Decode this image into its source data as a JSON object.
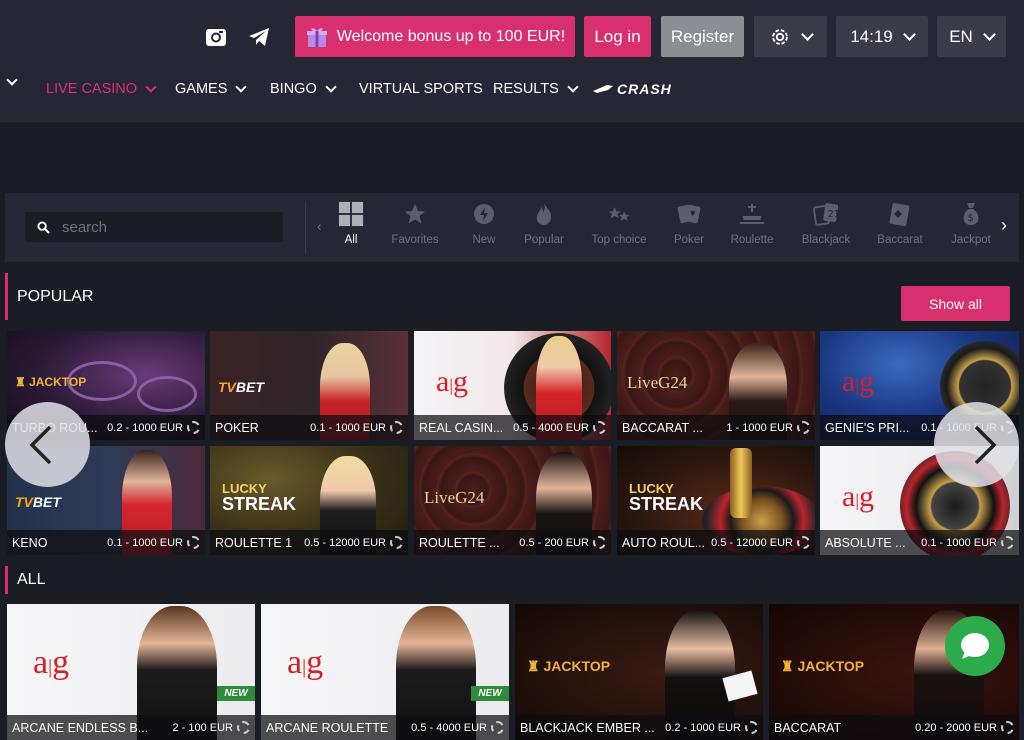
{
  "header": {
    "bonus_label": "Welcome bonus up to 100 EUR!",
    "login_label": "Log in",
    "register_label": "Register",
    "time": "14:19",
    "language": "EN",
    "social_icons": [
      "instagram-icon",
      "telegram-icon"
    ]
  },
  "nav": [
    {
      "label": "LIVE CASINO",
      "active": true
    },
    {
      "label": "GAMES"
    },
    {
      "label": "BINGO"
    },
    {
      "label": "VIRTUAL SPORTS"
    },
    {
      "label": "RESULTS"
    },
    {
      "label": "CRASH"
    }
  ],
  "search": {
    "placeholder": "search"
  },
  "categories": [
    "All",
    "Favorites",
    "New",
    "Popular",
    "Top choice",
    "Poker",
    "Roulette",
    "Blackjack",
    "Baccarat",
    "Jackpot"
  ],
  "sections": {
    "popular_title": "POPULAR",
    "show_all": "Show all",
    "all_title": "ALL"
  },
  "popular_games": [
    {
      "name": "TURBO ROU...",
      "range": "0.2 - 1000 EUR",
      "provider": "JACKTOP"
    },
    {
      "name": "POKER",
      "range": "0.1 - 1000 EUR",
      "provider": "TVBET"
    },
    {
      "name": "REAL CASIN...",
      "range": "0.5 - 4000 EUR",
      "provider": "alg"
    },
    {
      "name": "BACCARAT ...",
      "range": "1 - 1000 EUR",
      "provider": "LiveG24"
    },
    {
      "name": "GENIE'S PRI...",
      "range": "0.1 - 1000 EUR",
      "provider": "alg"
    },
    {
      "name": "KENO",
      "range": "0.1 - 1000 EUR",
      "provider": "TVBET"
    },
    {
      "name": "ROULETTE 1",
      "range": "0.5 - 12000 EUR",
      "provider": "LUCKY STREAK"
    },
    {
      "name": "ROULETTE ...",
      "range": "0.5 - 200 EUR",
      "provider": "LiveG24"
    },
    {
      "name": "AUTO ROUL...",
      "range": "0.5 - 12000 EUR",
      "provider": "LUCKY STREAK"
    },
    {
      "name": "ABSOLUTE ...",
      "range": "0.1 - 1000 EUR",
      "provider": "alg"
    }
  ],
  "all_games": [
    {
      "name": "ARCANE ENDLESS B...",
      "range": "2 - 100 EUR",
      "badge": "NEW"
    },
    {
      "name": "ARCANE ROULETTE",
      "range": "0.5 - 4000 EUR",
      "badge": "NEW"
    },
    {
      "name": "BLACKJACK EMBER ...",
      "range": "0.2 - 1000 EUR"
    },
    {
      "name": "BACCARAT",
      "range": "0.20 - 2000 EUR"
    }
  ],
  "logos": {
    "jacktop": "JACKTOP",
    "tvbet_tv": "TV",
    "tvbet_bet": "BET",
    "alg_a": "a",
    "alg_g": "g",
    "live24": "LiveG24",
    "lucky_top": "LUCKY",
    "lucky_bottom": "STREAK"
  },
  "colors": {
    "accent": "#d8306f",
    "background": "#1b1d25",
    "panel": "#252834",
    "chat": "#2bab4b"
  }
}
